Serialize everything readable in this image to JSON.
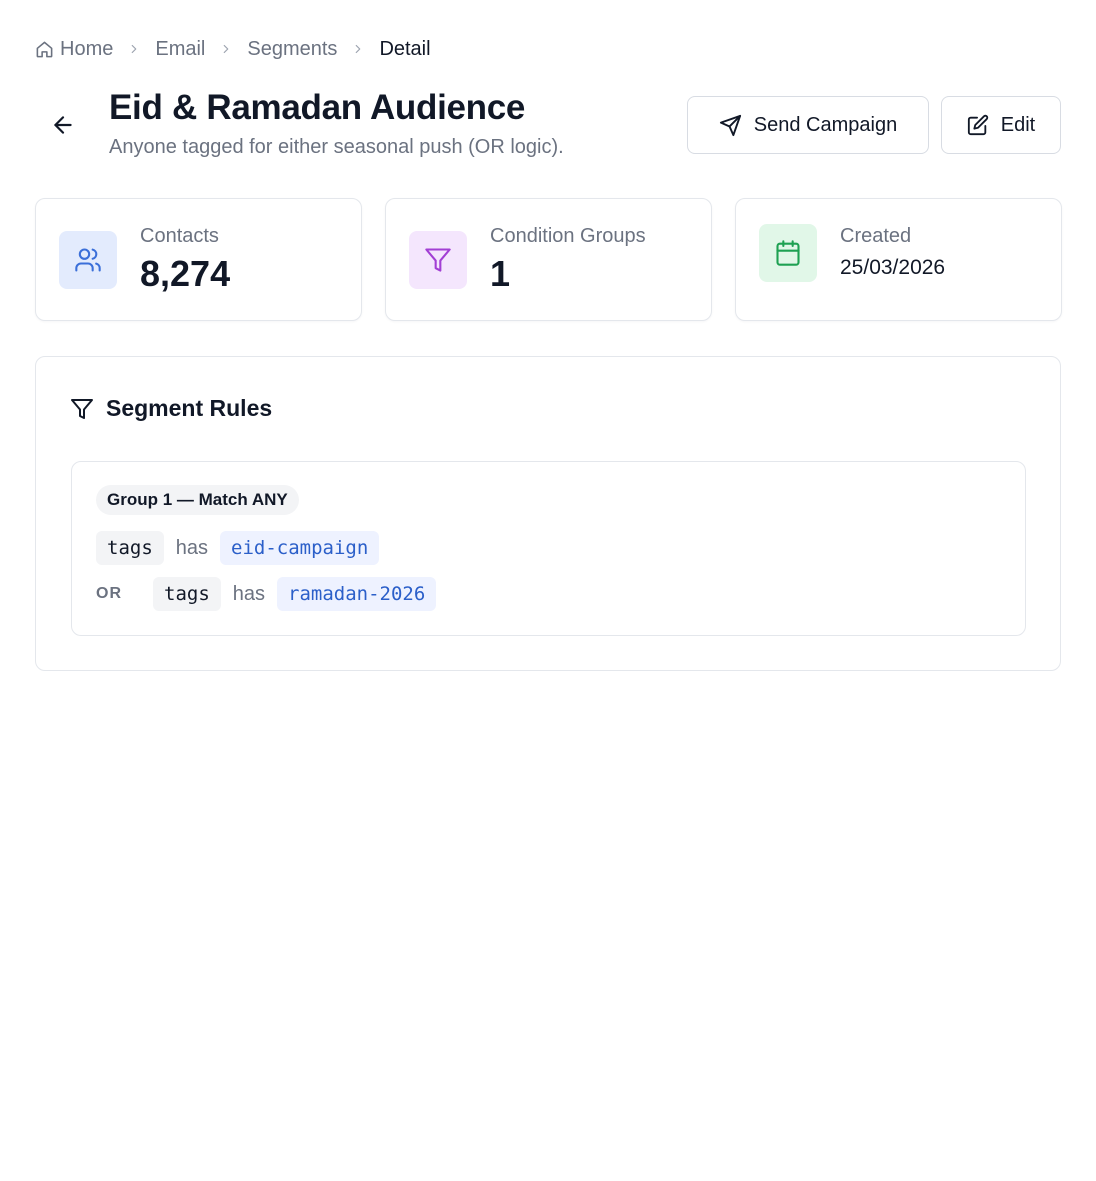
{
  "breadcrumb": {
    "items": [
      {
        "label": "Home",
        "icon": "home-icon"
      },
      {
        "label": "Email"
      },
      {
        "label": "Segments"
      },
      {
        "label": "Detail"
      }
    ]
  },
  "header": {
    "title": "Eid & Ramadan Audience",
    "subtitle": "Anyone tagged for either seasonal push (OR logic).",
    "back_icon": "arrow-left-icon"
  },
  "actions": {
    "send_label": "Send Campaign",
    "send_icon": "send-icon",
    "edit_label": "Edit",
    "edit_icon": "edit-icon"
  },
  "stats": [
    {
      "label": "Contacts",
      "value": "8,274",
      "icon": "users-icon",
      "icon_color": "#3b6fd9",
      "icon_bg": "#e3ebfd"
    },
    {
      "label": "Condition Groups",
      "value": "1",
      "icon": "filter-icon",
      "icon_color": "#a23fd4",
      "icon_bg": "#f4e6fd"
    },
    {
      "label": "Created",
      "value": "25/03/2026",
      "icon": "calendar-icon",
      "icon_color": "#1ea152",
      "icon_bg": "#e1f7e8"
    }
  ],
  "rules": {
    "title": "Segment Rules",
    "icon": "filter-icon",
    "groups": [
      {
        "label": "Group 1 — Match ANY",
        "conditions": [
          {
            "logic": "",
            "field": "tags",
            "operator": "has",
            "value": "eid-campaign"
          },
          {
            "logic": "OR",
            "field": "tags",
            "operator": "has",
            "value": "ramadan-2026"
          }
        ]
      }
    ]
  },
  "colors": {
    "accent": "#2b5fc9",
    "text": "#111827",
    "muted": "#6b7280",
    "border": "#e4e7ec"
  }
}
